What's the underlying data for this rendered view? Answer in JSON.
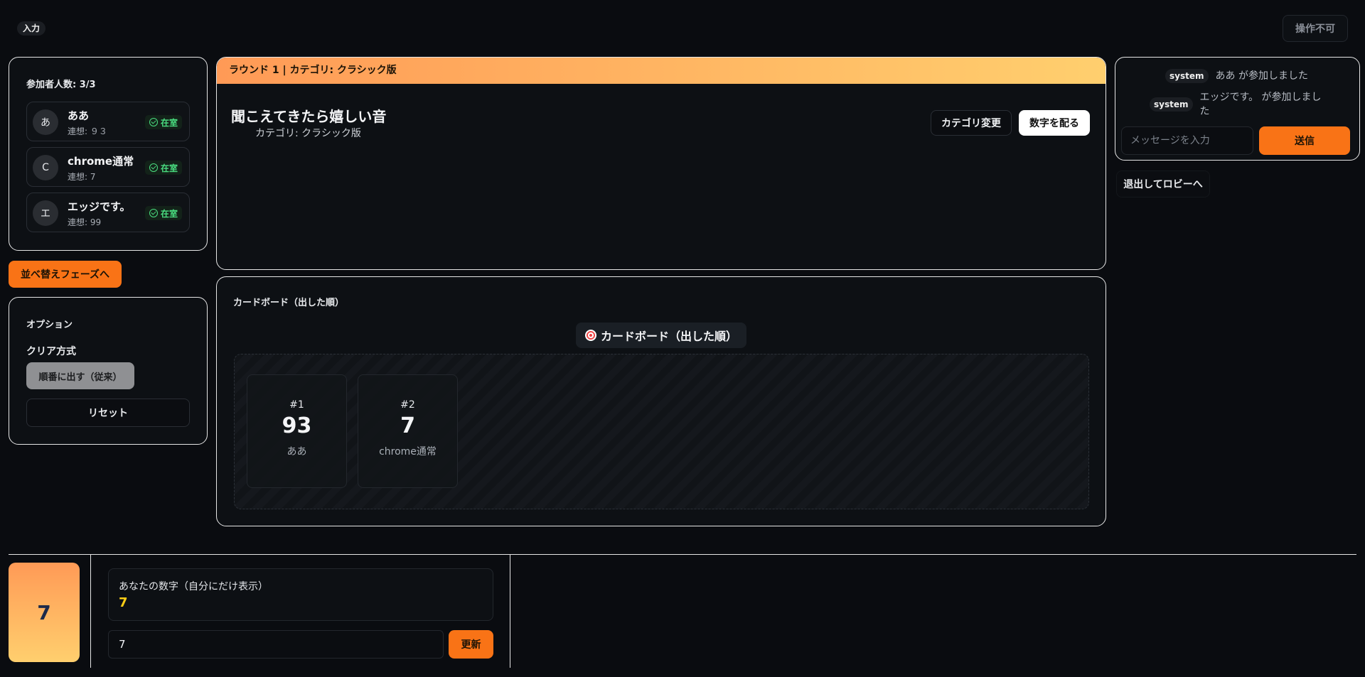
{
  "header": {
    "mode_tag": "入力",
    "disabled_button": "操作不可"
  },
  "participants": {
    "title": "参加者人数: 3/3",
    "items": [
      {
        "initial": "あ",
        "name": "ああ",
        "sub": "連想: ９３",
        "status": "在室"
      },
      {
        "initial": "C",
        "name": "chrome通常",
        "sub": "連想: 7",
        "status": "在室"
      },
      {
        "initial": "エ",
        "name": "エッジです。",
        "sub": "連想: 99",
        "status": "在室"
      }
    ]
  },
  "sort_button": "並べ替えフェーズへ",
  "options": {
    "title": "オプション",
    "clear_label": "クリア方式",
    "clear_value": "順番に出す（従来）",
    "reset": "リセット"
  },
  "topic": {
    "round_bar": "ラウンド 1 | カテゴリ: クラシック版",
    "title": "聞こえてきたら嬉しい音",
    "category": "カテゴリ: クラシック版",
    "change_category": "カテゴリ変更",
    "deal_numbers": "数字を配る"
  },
  "board": {
    "header": "カードボード（出した順）",
    "pill": "カードボード（出した順）",
    "cards": [
      {
        "index": "#1",
        "value": "93",
        "player": "ああ"
      },
      {
        "index": "#2",
        "value": "7",
        "player": "chrome通常"
      }
    ]
  },
  "chat": {
    "messages": [
      {
        "sender": "system",
        "text": "ああ が参加しました"
      },
      {
        "sender": "system",
        "text": "エッジです。 が参加しました"
      }
    ],
    "placeholder": "メッセージを入力",
    "send": "送信",
    "leave": "退出してロビーへ"
  },
  "my_number": {
    "card_value": "7",
    "label": "あなたの数字（自分にだけ表示）",
    "value": "7",
    "input_value": "7",
    "update": "更新"
  },
  "colors": {
    "accent": "#f97316",
    "present": "#4ade80",
    "number_highlight": "#facc15"
  }
}
